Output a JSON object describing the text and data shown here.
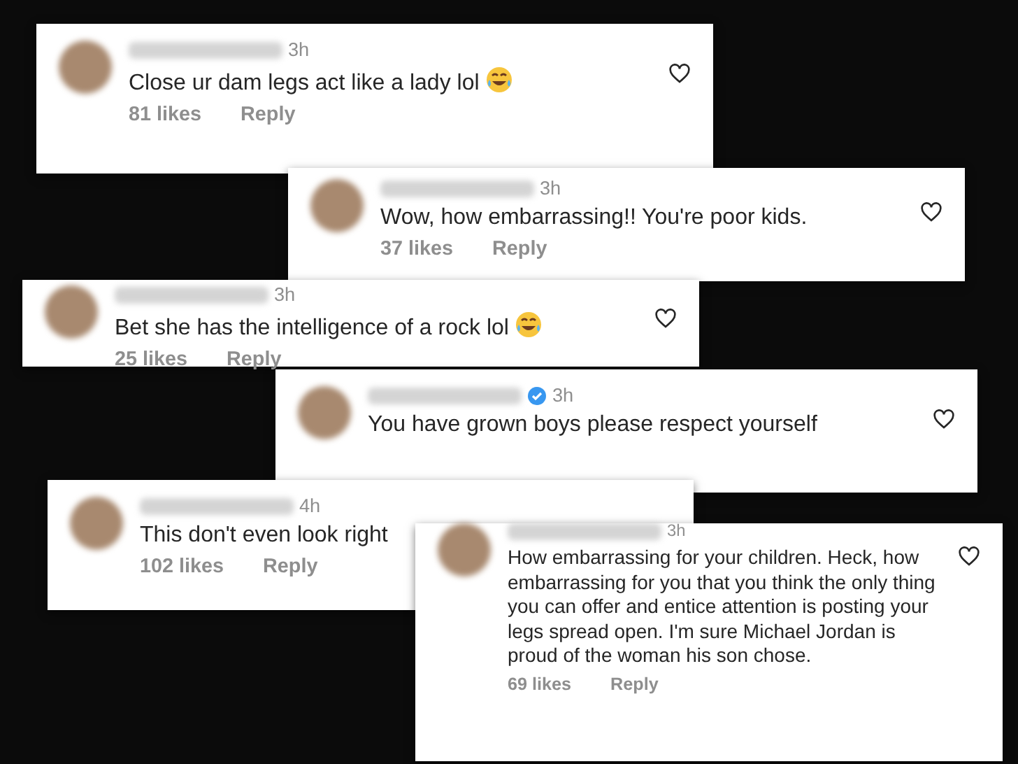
{
  "comments": [
    {
      "time": "3h",
      "verified": false,
      "text": "Close ur dam legs act like a lady lol",
      "emoji": true,
      "likes": "81 likes",
      "reply": "Reply",
      "show_heart": true
    },
    {
      "time": "3h",
      "verified": false,
      "text": "Wow, how embarrassing!! You're poor kids.",
      "emoji": false,
      "likes": "37 likes",
      "reply": "Reply",
      "show_heart": true
    },
    {
      "time": "3h",
      "verified": false,
      "text": "Bet she has the intelligence of a rock lol",
      "emoji": true,
      "likes": "25 likes",
      "reply": "Reply",
      "show_heart": true
    },
    {
      "time": "3h",
      "verified": true,
      "text": "You have grown boys please respect yourself",
      "emoji": false,
      "show_heart": true
    },
    {
      "time": "4h",
      "verified": false,
      "text": "This don't even look right",
      "emoji": false,
      "likes": "102 likes",
      "reply": "Reply",
      "show_heart": false
    },
    {
      "time": "3h",
      "verified": false,
      "text": "How embarrassing for your children.  Heck, how embarrassing for you that you think the only thing you can offer and entice attention is posting your legs spread open. I'm sure Michael Jordan is proud of the woman his son chose.",
      "emoji": false,
      "likes": "69 likes",
      "reply": "Reply",
      "show_heart": true
    }
  ]
}
